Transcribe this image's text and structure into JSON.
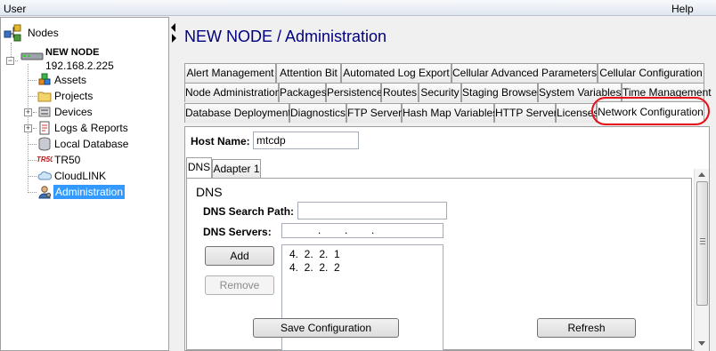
{
  "menu": {
    "user": "User",
    "help": "Help"
  },
  "tree": {
    "root_label": "Nodes",
    "node_name": "NEW NODE",
    "node_ip": "192.168.2.225",
    "items": [
      "Assets",
      "Projects",
      "Devices",
      "Logs & Reports",
      "Local Database",
      "TR50",
      "CloudLINK",
      "Administration"
    ],
    "selected": "Administration"
  },
  "page_title": "NEW NODE / Administration",
  "tabs": {
    "row1": [
      "Alert Management",
      "Attention Bit",
      "Automated Log Export",
      "Cellular Advanced Parameters",
      "Cellular Configuration"
    ],
    "row2": [
      "Node Administration",
      "Packages",
      "Persistence",
      "Routes",
      "Security",
      "Staging Browser",
      "System Variables",
      "Time Management"
    ],
    "row3": [
      "Database Deployment",
      "Diagnostics",
      "FTP Server",
      "Hash Map Variables",
      "HTTP Server",
      "Licenses",
      "Network Configuration"
    ],
    "active": "Network Configuration"
  },
  "hostname": {
    "label": "Host Name:",
    "value": "mtcdp"
  },
  "subtabs": [
    "DNS",
    "Adapter 1"
  ],
  "dns": {
    "heading": "DNS",
    "search_path_label": "DNS Search Path:",
    "search_path_value": "",
    "servers_label": "DNS Servers:",
    "servers_mask": ".        .        .",
    "list": [
      "4.  2.  2.  1",
      "4.  2.  2.  2"
    ],
    "add_label": "Add",
    "remove_label": "Remove"
  },
  "footer": {
    "save_label": "Save Configuration",
    "refresh_label": "Refresh"
  },
  "colors": {
    "title": "#00007f",
    "selection": "#3399ff",
    "highlight_ring": "#e8101a"
  }
}
